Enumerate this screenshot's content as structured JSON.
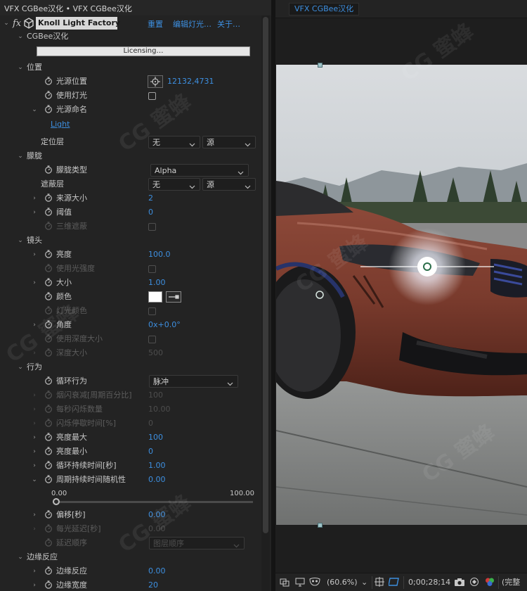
{
  "panel": {
    "title": "VFX CGBee汉化 • VFX CGBee汉化",
    "effect_name": "Knoll Light Factory",
    "links": {
      "reset": "重置",
      "edit_light": "编辑灯光…",
      "about": "关于…"
    },
    "group_label": "CGBee汉化",
    "licensing_button": "Licensing…",
    "sections": {
      "position": "位置",
      "occlusion": "朦胧",
      "lens": "镜头",
      "behavior": "行为",
      "edge": "边缘反应"
    },
    "rows": {
      "light_source_position": {
        "label": "光源位置",
        "value": "12132,4731"
      },
      "use_lights": {
        "label": "使用灯光"
      },
      "light_source_naming": {
        "label": "光源命名",
        "value": "Light"
      },
      "locator_layer": {
        "label": "定位层",
        "option1": "无",
        "option2": "源"
      },
      "occlusion_type": {
        "label": "朦胧类型",
        "value": "Alpha"
      },
      "matte_layer": {
        "label": "遮蔽层",
        "option1": "无",
        "option2": "源"
      },
      "source_size": {
        "label": "来源大小",
        "value": "2"
      },
      "threshold": {
        "label": "阈值",
        "value": "0"
      },
      "3d_occlusion": {
        "label": "三维遮蔽"
      },
      "brightness": {
        "label": "亮度",
        "value": "100.0"
      },
      "use_light_intensity": {
        "label": "使用光强度"
      },
      "scale": {
        "label": "大小",
        "value": "1.00"
      },
      "color": {
        "label": "颜色",
        "swatch": "#ffffff"
      },
      "light_color": {
        "label": "灯光颜色"
      },
      "angle": {
        "label": "角度",
        "value": "0x+0.0°"
      },
      "use_depth_size": {
        "label": "使用深度大小"
      },
      "depth_size": {
        "label": "深度大小",
        "value": "500"
      },
      "loop_behavior": {
        "label": "循环行为",
        "value": "脉冲"
      },
      "flicker_decay": {
        "label": "烟闪衰减[周期百分比]",
        "value": "100"
      },
      "flickers_per_second": {
        "label": "每秒闪烁数量",
        "value": "10.00"
      },
      "flicker_pause": {
        "label": "闪烁停歇时间[%]",
        "value": "0"
      },
      "brightness_max": {
        "label": "亮度最大",
        "value": "100"
      },
      "brightness_min": {
        "label": "亮度最小",
        "value": "0"
      },
      "loop_duration": {
        "label": "循环持续时间[秒]",
        "value": "1.00"
      },
      "cycle_randomness": {
        "label": "周期持续时间随机性",
        "value": "0.00",
        "slider_min": "0.00",
        "slider_max": "100.00",
        "slider_fraction": 0.0
      },
      "offset": {
        "label": "偏移[秒]",
        "value": "0.00"
      },
      "per_light_delay": {
        "label": "每光延迟[秒]",
        "value": "0.00"
      },
      "delay_order": {
        "label": "延迟顺序",
        "value": "图层顺序"
      },
      "edge_reaction": {
        "label": "边缘反应",
        "value": "0.00"
      },
      "edge_width": {
        "label": "边缘宽度",
        "value": "20"
      }
    }
  },
  "viewer": {
    "tab_label": "VFX CGBee汉化",
    "zoom": "(60.6%)",
    "timecode": "0;00;28;14",
    "resolution": "(完整"
  },
  "watermark": "CG 蜜蜂"
}
